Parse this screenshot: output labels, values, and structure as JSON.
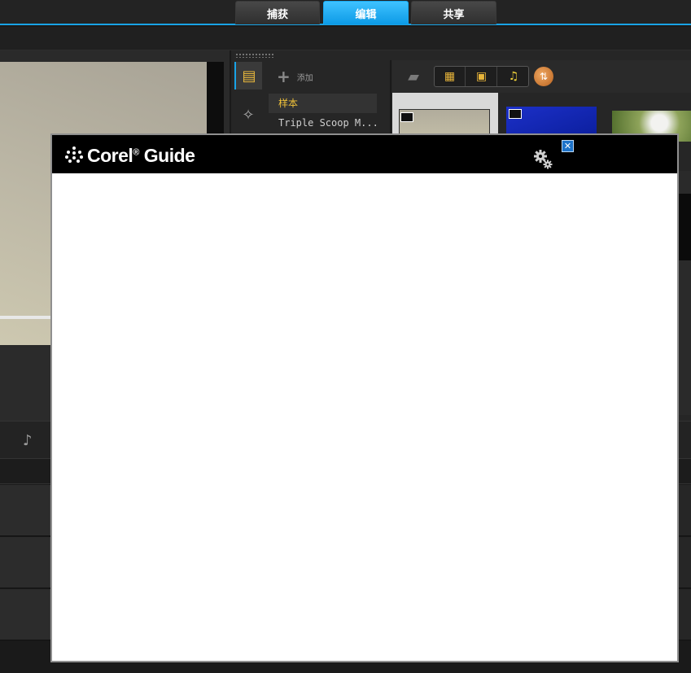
{
  "tabs": [
    {
      "label": "捕获",
      "active": false
    },
    {
      "label": "编辑",
      "active": true
    },
    {
      "label": "共享",
      "active": false
    }
  ],
  "library": {
    "add_label": "添加",
    "folders": [
      "样本",
      "Triple Scoop M..."
    ]
  },
  "guide": {
    "title": "Corel",
    "title_reg": "®",
    "title_suffix": " Guide",
    "close_label": "✕"
  },
  "colors": {
    "accent": "#19a3e6",
    "selected_folder": "#f0c23a",
    "guide_close": "#1e73c9"
  },
  "icons": {
    "media": "media-library-icon",
    "fx": "effects-icon",
    "add": "plus-icon",
    "folder": "folder-open-icon",
    "video_filter": "video-filter-icon",
    "photo_filter": "photo-filter-icon",
    "audio_filter": "music-note-icon",
    "sort": "sort-icon",
    "settings": "gear-icon",
    "close": "close-icon"
  }
}
